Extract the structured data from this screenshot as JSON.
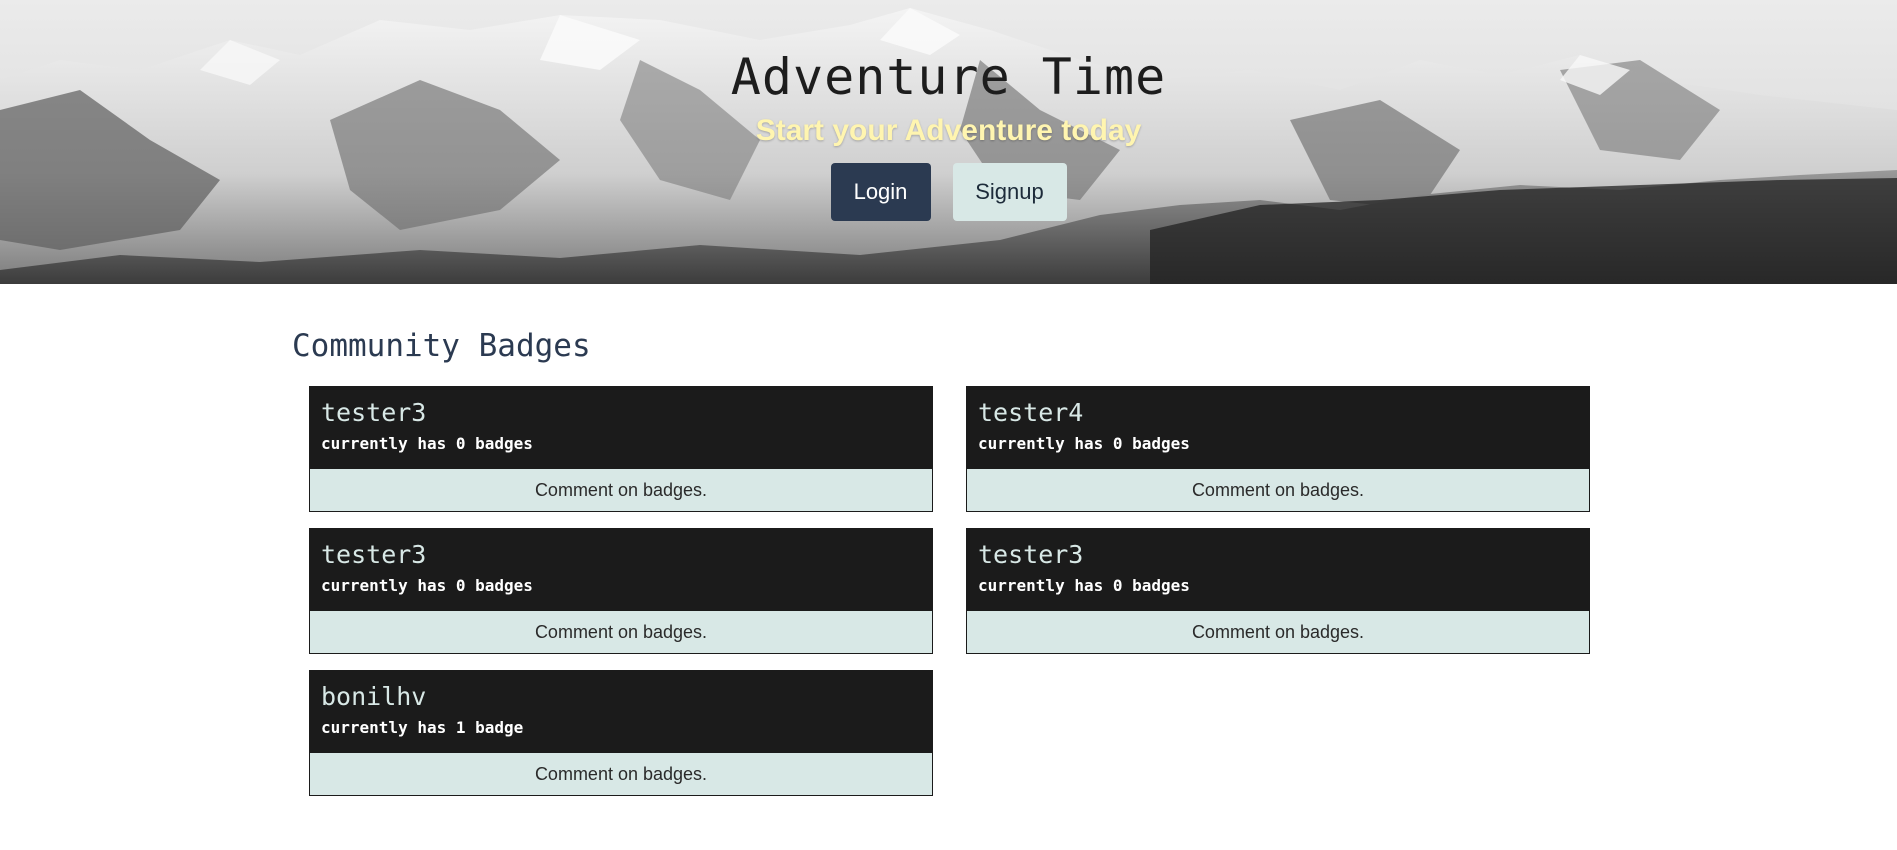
{
  "hero": {
    "title": "Adventure Time",
    "subtitle": "Start your Adventure today",
    "login_label": "Login",
    "signup_label": "Signup"
  },
  "section": {
    "title": "Community Badges"
  },
  "cards": [
    {
      "name": "tester3",
      "count_text": "currently has 0 badges",
      "comment_label": "Comment on badges."
    },
    {
      "name": "tester4",
      "count_text": "currently has 0 badges",
      "comment_label": "Comment on badges."
    },
    {
      "name": "tester3",
      "count_text": "currently has 0 badges",
      "comment_label": "Comment on badges."
    },
    {
      "name": "tester3",
      "count_text": "currently has 0 badges",
      "comment_label": "Comment on badges."
    },
    {
      "name": "bonilhv",
      "count_text": "currently has 1 badge",
      "comment_label": "Comment on badges."
    }
  ],
  "colors": {
    "login_bg": "#2b3a51",
    "signup_bg": "#d8e8e6",
    "card_head_bg": "#1b1b1b",
    "card_foot_bg": "#d8e8e6",
    "subtitle": "#fff5b0"
  }
}
